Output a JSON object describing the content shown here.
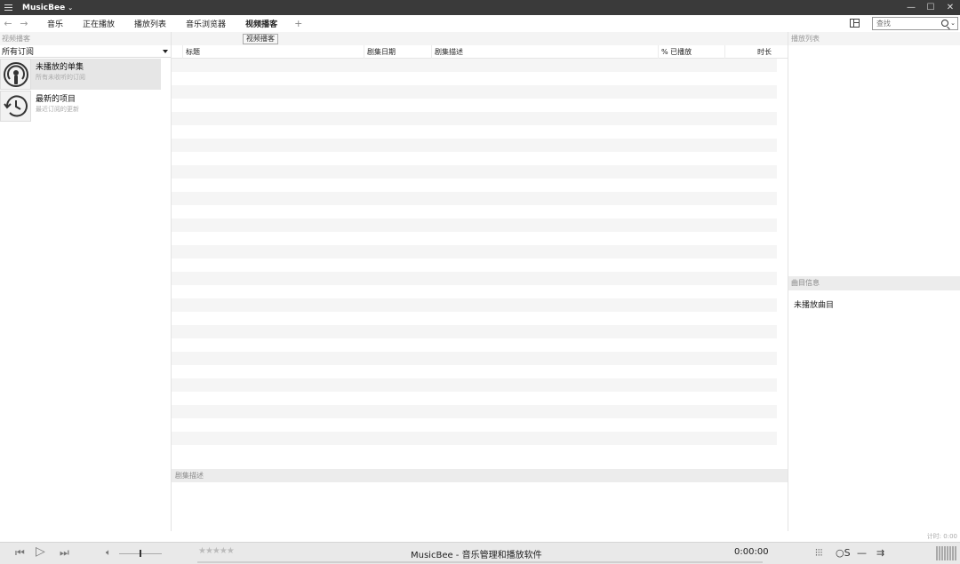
{
  "app": {
    "title": "MusicBee"
  },
  "nav": {
    "tabs": [
      {
        "label": "音乐"
      },
      {
        "label": "正在播放"
      },
      {
        "label": "播放列表"
      },
      {
        "label": "音乐浏览器"
      },
      {
        "label": "视频播客"
      }
    ],
    "active_tab": "视频播客",
    "tooltip": "视频播客",
    "search_placeholder": "查找"
  },
  "left_panel": {
    "header": "视频播客",
    "filter_value": "所有订阅",
    "feeds": [
      {
        "title": "未播放的单集",
        "subtitle": "所有未收听的订阅",
        "icon": "podcast-icon"
      },
      {
        "title": "最新的项目",
        "subtitle": "最近订阅的更新",
        "icon": "history-clock-icon"
      }
    ]
  },
  "episode_list": {
    "columns": [
      "标题",
      "剧集日期",
      "剧集描述",
      "% 已播放",
      "时长"
    ],
    "rows": []
  },
  "description_panel": {
    "header": "剧集描述"
  },
  "right_panel": {
    "playlist_header": "播放列表",
    "track_info_header": "曲目信息",
    "track_info_text": "未播放曲目"
  },
  "status": {
    "timer": "计时: 0:00"
  },
  "player": {
    "now_playing": "MusicBee - 音乐管理和播放软件",
    "time": "0:00:00",
    "rating": "★★★★★"
  }
}
